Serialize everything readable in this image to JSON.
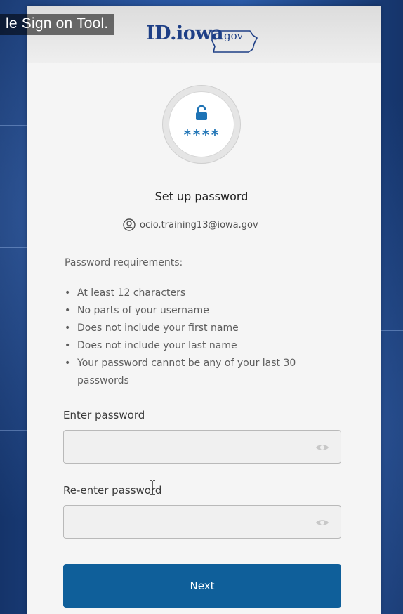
{
  "video_caption": "le Sign on Tool.",
  "logo": {
    "main": "ID.iowa",
    "suffix": "gov"
  },
  "badge": {
    "icon": "lock-icon",
    "mask": "****"
  },
  "heading": "Set up password",
  "identity": {
    "icon": "user-circle-icon",
    "username": "ocio.training13@iowa.gov"
  },
  "requirements": {
    "title": "Password requirements:",
    "items": [
      "At least 12 characters",
      "No parts of your username",
      "Does not include your first name",
      "Does not include your last name",
      "Your password cannot be any of your last 30 passwords"
    ]
  },
  "fields": {
    "password": {
      "label": "Enter password",
      "value": "",
      "toggle_icon": "eye-icon"
    },
    "confirm": {
      "label": "Re-enter password",
      "value": "",
      "toggle_icon": "eye-icon"
    }
  },
  "next_button": "Next",
  "colors": {
    "primary": "#0f5f9a",
    "logo": "#1e3f86",
    "lock": "#1e73b5",
    "background": "#1b3f7a"
  }
}
